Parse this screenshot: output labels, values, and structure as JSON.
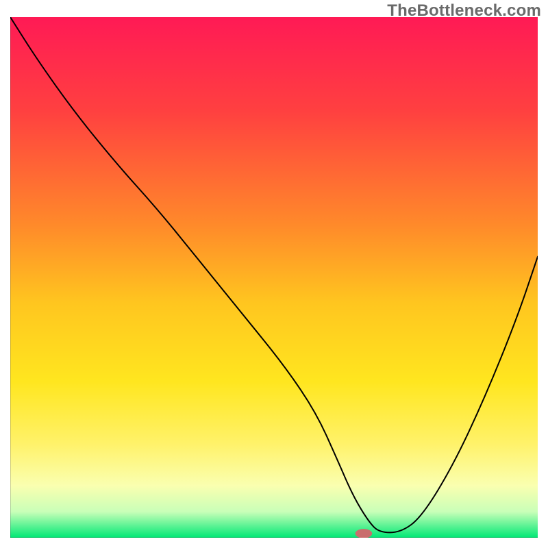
{
  "watermark": "TheBottleneck.com",
  "chart_data": {
    "type": "line",
    "title": "",
    "xlabel": "",
    "ylabel": "",
    "xlim": [
      0,
      100
    ],
    "ylim": [
      0,
      100
    ],
    "gradient_bands": [
      {
        "color": "#ff1a55",
        "stop": 0
      },
      {
        "color": "#ff4040",
        "stop": 18
      },
      {
        "color": "#ff8a2a",
        "stop": 40
      },
      {
        "color": "#ffc61f",
        "stop": 55
      },
      {
        "color": "#ffe61f",
        "stop": 70
      },
      {
        "color": "#fff26a",
        "stop": 82
      },
      {
        "color": "#faffb0",
        "stop": 90
      },
      {
        "color": "#c9ffb8",
        "stop": 95
      },
      {
        "color": "#00e875",
        "stop": 100
      }
    ],
    "series": [
      {
        "name": "bottleneck-curve",
        "x": [
          0,
          5,
          12,
          20,
          28,
          36,
          44,
          52,
          58,
          62,
          65,
          68,
          70,
          74,
          78,
          84,
          90,
          96,
          100
        ],
        "y": [
          100,
          92,
          82,
          72,
          63,
          53,
          43,
          33,
          24,
          15,
          8,
          3,
          1,
          1,
          4,
          14,
          27,
          42,
          54
        ]
      }
    ],
    "marker": {
      "name": "optimal-point",
      "x": 67,
      "y": 0.8,
      "color": "#c96d6d"
    }
  }
}
